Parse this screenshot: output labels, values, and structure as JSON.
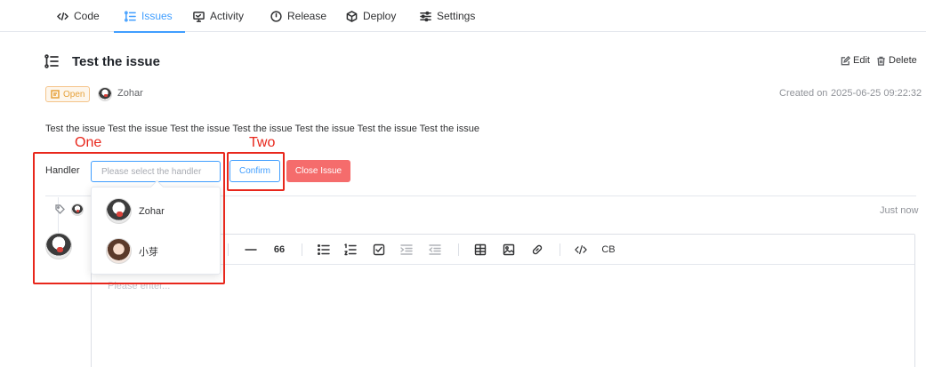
{
  "nav": {
    "tabs": [
      {
        "label": "Code",
        "icon": "code-icon"
      },
      {
        "label": "Issues",
        "icon": "list-icon",
        "active": true
      },
      {
        "label": "Activity",
        "icon": "monitor-icon"
      },
      {
        "label": "Release",
        "icon": "clock-icon"
      },
      {
        "label": "Deploy",
        "icon": "cube-icon"
      },
      {
        "label": "Settings",
        "icon": "sliders-icon"
      }
    ]
  },
  "issue": {
    "title": "Test the issue",
    "edit_label": "Edit",
    "delete_label": "Delete",
    "status": "Open",
    "author": "Zohar",
    "created_label": "Created on",
    "created_value": "2025-06-25 09:22:32",
    "description": "Test the issue Test the issue Test the issue Test the issue Test the issue Test the issue Test the issue"
  },
  "annotations": {
    "one": "One",
    "two": "Two"
  },
  "handler": {
    "label": "Handler",
    "placeholder": "Please select the handler",
    "confirm_label": "Confirm",
    "close_label": "Close Issue",
    "options": [
      {
        "name": "Zohar"
      },
      {
        "name": "小芽"
      }
    ]
  },
  "timeline": {
    "time": "Just now"
  },
  "editor": {
    "placeholder": "Please enter...",
    "quote_label": "66",
    "cb_label": "CB"
  },
  "colors": {
    "primary": "#409eff",
    "danger": "#f56c6c",
    "warning": "#e6a23c",
    "annotation": "#e8271c"
  }
}
